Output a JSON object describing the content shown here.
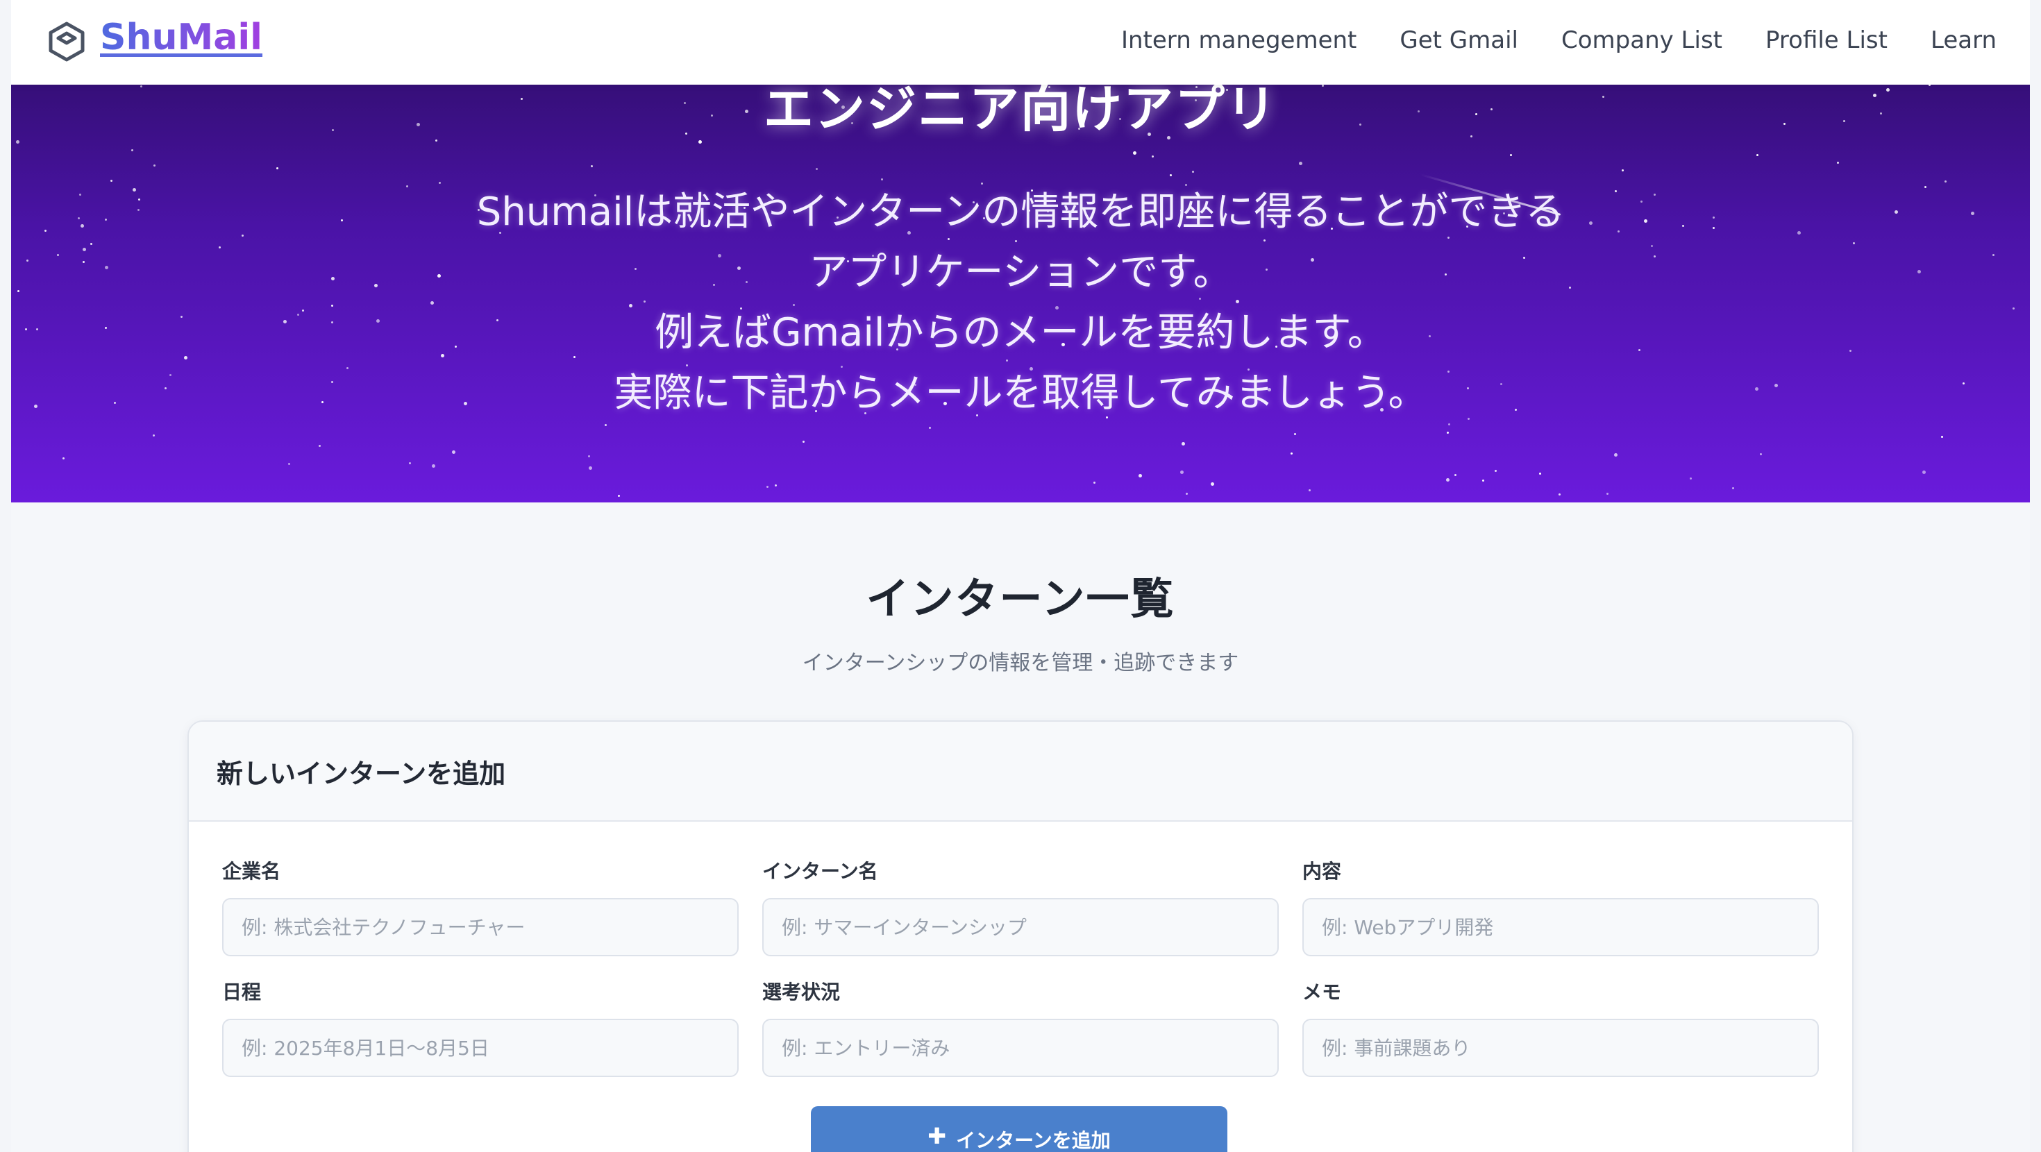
{
  "nav": {
    "brand": "ShuMail",
    "links": [
      "Intern manegement",
      "Get Gmail",
      "Company List",
      "Profile List",
      "Learn"
    ]
  },
  "hero": {
    "title": "エンジニア向けアプリ",
    "lines": [
      "Shumailは就活やインターンの情報を即座に得ることができる",
      "アプリケーションです。",
      "例えばGmailからのメールを要約します。",
      "実際に下記からメールを取得してみましょう。"
    ]
  },
  "main": {
    "title": "インターン一覧",
    "subtitle": "インターンシップの情報を管理・追跡できます"
  },
  "form": {
    "header": "新しいインターンを追加",
    "fields": [
      {
        "label": "企業名",
        "placeholder": "例: 株式会社テクノフューチャー"
      },
      {
        "label": "インターン名",
        "placeholder": "例: サマーインターンシップ"
      },
      {
        "label": "内容",
        "placeholder": "例: Webアプリ開発"
      },
      {
        "label": "日程",
        "placeholder": "例: 2025年8月1日〜8月5日"
      },
      {
        "label": "選考状況",
        "placeholder": "例: エントリー済み"
      },
      {
        "label": "メモ",
        "placeholder": "例: 事前課題あり"
      }
    ],
    "submit_label": "インターンを追加",
    "submit_icon": "plus-icon"
  },
  "colors": {
    "hero_top": "#2a0c5e",
    "hero_bottom": "#6a1bdc",
    "brand_gradient_start": "#4f6ae0",
    "brand_gradient_end": "#a13fe0",
    "button": "#4a80cc"
  }
}
